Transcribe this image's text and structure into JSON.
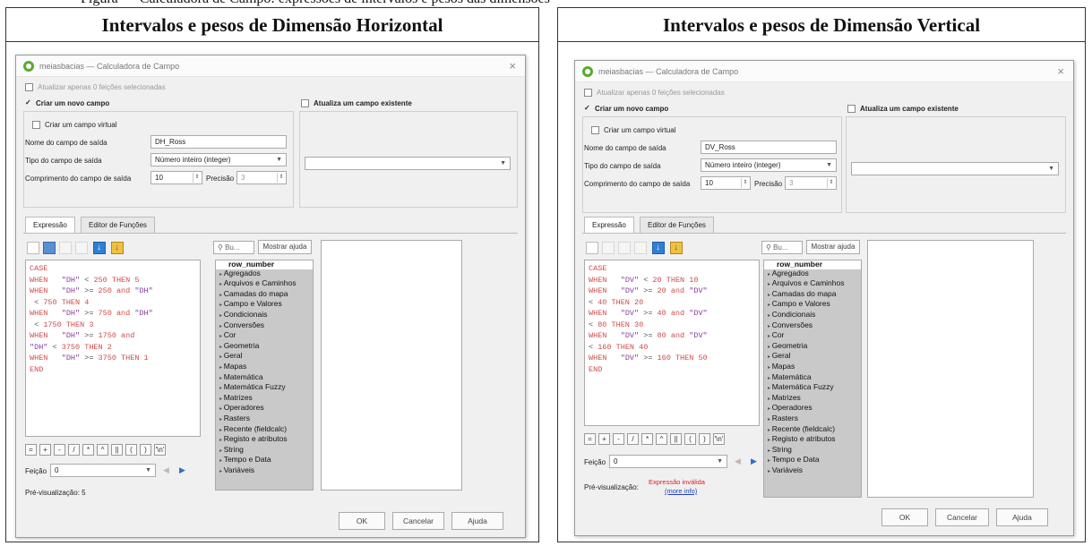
{
  "top_caption": "Figura — Calculadora de Campo: expressões de intervalos e pesos das dimensões",
  "panels": [
    {
      "title": "Intervalos e pesos de Dimensão Horizontal",
      "window_title": "meiasbacias — Calculadora de Campo",
      "close": "×",
      "update_selected": "Atualizar apenas 0 feições selecionadas",
      "create_new_field": "Criar um novo campo",
      "update_existing": "Atualiza um campo existente",
      "virtual_field": "Criar um campo virtual",
      "output_name_label": "Nome do campo de saída",
      "output_name_value": "DH_Ross",
      "output_type_label": "Tipo do campo de saída",
      "output_type_value": "Número inteiro (integer)",
      "output_length_label": "Comprimento do campo de saída",
      "output_length_value": "10",
      "precision_label": "Precisão",
      "precision_value": "3",
      "tab_expression": "Expressão",
      "tab_function_editor": "Editor de Funções",
      "code": [
        [
          [
            "CASE",
            "kw"
          ]
        ],
        [
          [
            "WHEN   ",
            "kw"
          ],
          [
            "\"DH\"",
            "fld"
          ],
          [
            " < ",
            ""
          ],
          [
            "250",
            "num"
          ],
          [
            " THEN ",
            "kw"
          ],
          [
            "5",
            "num"
          ]
        ],
        [
          [
            "WHEN   ",
            "kw"
          ],
          [
            "\"DH\"",
            "fld"
          ],
          [
            " >= ",
            ""
          ],
          [
            "250",
            "num"
          ],
          [
            " and ",
            "kw"
          ],
          [
            "\"DH\"",
            "fld"
          ]
        ],
        [
          [
            " < ",
            ""
          ],
          [
            "750",
            "num"
          ],
          [
            " THEN ",
            "kw"
          ],
          [
            "4",
            "num"
          ]
        ],
        [
          [
            "WHEN   ",
            "kw"
          ],
          [
            "\"DH\"",
            "fld"
          ],
          [
            " >= ",
            ""
          ],
          [
            "750",
            "num"
          ],
          [
            " and ",
            "kw"
          ],
          [
            "\"DH\"",
            "fld"
          ]
        ],
        [
          [
            " < ",
            ""
          ],
          [
            "1750",
            "num"
          ],
          [
            " THEN ",
            "kw"
          ],
          [
            "3",
            "num"
          ]
        ],
        [
          [
            "WHEN   ",
            "kw"
          ],
          [
            "\"DH\"",
            "fld"
          ],
          [
            " >= ",
            ""
          ],
          [
            "1750",
            "num"
          ],
          [
            " and",
            "kw"
          ]
        ],
        [
          [
            "\"DH\"",
            "fld"
          ],
          [
            " < ",
            ""
          ],
          [
            "3750",
            "num"
          ],
          [
            " THEN ",
            "kw"
          ],
          [
            "2",
            "num"
          ]
        ],
        [
          [
            "WHEN   ",
            "kw"
          ],
          [
            "\"DH\"",
            "fld"
          ],
          [
            " >= ",
            ""
          ],
          [
            "3750",
            "num"
          ],
          [
            " THEN ",
            "kw"
          ],
          [
            "1",
            "num"
          ]
        ],
        [
          [
            "END",
            "kw"
          ]
        ]
      ],
      "search_placeholder": "Bu...",
      "show_help": "Mostrar ajuda",
      "functions_head": "row_number",
      "functions": [
        "Agregados",
        "Arquivos e Caminhos",
        "Camadas do mapa",
        "Campo e Valores",
        "Condicionais",
        "Conversões",
        "Cor",
        "Geometria",
        "Geral",
        "Mapas",
        "Matemática",
        "Matemática Fuzzy",
        "Matrizes",
        "Operadores",
        "Rasters",
        "Recente (fieldcalc)",
        "Registo e atributos",
        "String",
        "Tempo e Data",
        "Variáveis"
      ],
      "operators": [
        "=",
        "+",
        "-",
        "/",
        "*",
        "^",
        "||",
        "(",
        ")",
        "'\\n'"
      ],
      "feature_label": "Feição",
      "feature_value": "0",
      "preview_label": "Pré-visualização:",
      "preview_value": "5",
      "preview_error": "",
      "preview_more": "",
      "ok": "OK",
      "cancel": "Cancelar",
      "help": "Ajuda"
    },
    {
      "title": "Intervalos e pesos de Dimensão Vertical",
      "window_title": "meiasbacias — Calculadora de Campo",
      "close": "×",
      "update_selected": "Atualizar apenas 0 feições selecionadas",
      "create_new_field": "Criar um novo campo",
      "update_existing": "Atualiza um campo existente",
      "virtual_field": "Criar um campo virtual",
      "output_name_label": "Nome do campo de saída",
      "output_name_value": "DV_Ross",
      "output_type_label": "Tipo do campo de saída",
      "output_type_value": "Número inteiro (integer)",
      "output_length_label": "Comprimento do campo de saída",
      "output_length_value": "10",
      "precision_label": "Precisão",
      "precision_value": "3",
      "tab_expression": "Expressão",
      "tab_function_editor": "Editor de Funções",
      "code": [
        [
          [
            "CASE",
            "kw"
          ]
        ],
        [
          [
            "WHEN   ",
            "kw"
          ],
          [
            "\"DV\"",
            "fld"
          ],
          [
            " < ",
            ""
          ],
          [
            "20",
            "num"
          ],
          [
            " THEN ",
            "kw"
          ],
          [
            "10",
            "num"
          ]
        ],
        [
          [
            "WHEN   ",
            "kw"
          ],
          [
            "\"DV\"",
            "fld"
          ],
          [
            " >= ",
            ""
          ],
          [
            "20",
            "num"
          ],
          [
            " and ",
            "kw"
          ],
          [
            "\"DV\"",
            "fld"
          ]
        ],
        [
          [
            "< ",
            ""
          ],
          [
            "40",
            "num"
          ],
          [
            " THEN ",
            "kw"
          ],
          [
            "20",
            "num"
          ]
        ],
        [
          [
            "WHEN   ",
            "kw"
          ],
          [
            "\"DV\"",
            "fld"
          ],
          [
            " >= ",
            ""
          ],
          [
            "40",
            "num"
          ],
          [
            " and ",
            "kw"
          ],
          [
            "\"DV\"",
            "fld"
          ]
        ],
        [
          [
            "< ",
            ""
          ],
          [
            "80",
            "num"
          ],
          [
            " THEN ",
            "kw"
          ],
          [
            "30",
            "num"
          ]
        ],
        [
          [
            "WHEN   ",
            "kw"
          ],
          [
            "\"DV\"",
            "fld"
          ],
          [
            " >= ",
            ""
          ],
          [
            "80",
            "num"
          ],
          [
            " and ",
            "kw"
          ],
          [
            "\"DV\"",
            "fld"
          ]
        ],
        [
          [
            "< ",
            ""
          ],
          [
            "160",
            "num"
          ],
          [
            " THEN ",
            "kw"
          ],
          [
            "40",
            "num"
          ]
        ],
        [
          [
            "WHEN   ",
            "kw"
          ],
          [
            "\"DV\"",
            "fld"
          ],
          [
            " >= ",
            ""
          ],
          [
            "160",
            "num"
          ],
          [
            " THEN ",
            "kw"
          ],
          [
            "50",
            "num"
          ]
        ],
        [
          [
            "END",
            "kw"
          ]
        ]
      ],
      "search_placeholder": "Bu...",
      "show_help": "Mostrar ajuda",
      "functions_head": "row_number",
      "functions": [
        "Agregados",
        "Arquivos e Caminhos",
        "Camadas do mapa",
        "Campo e Valores",
        "Condicionais",
        "Conversões",
        "Cor",
        "Geometria",
        "Geral",
        "Mapas",
        "Matemática",
        "Matemática Fuzzy",
        "Matrizes",
        "Operadores",
        "Rasters",
        "Recente (fieldcalc)",
        "Registo e atributos",
        "String",
        "Tempo e Data",
        "Variáveis"
      ],
      "operators": [
        "=",
        "+",
        "-",
        "/",
        "*",
        "^",
        "||",
        "(",
        ")",
        "'\\n'"
      ],
      "feature_label": "Feição",
      "feature_value": "0",
      "preview_label": "Pré-visualização:",
      "preview_value": "",
      "preview_error": "Expressão inválida",
      "preview_more": "(more info)",
      "ok": "OK",
      "cancel": "Cancelar",
      "help": "Ajuda"
    }
  ]
}
